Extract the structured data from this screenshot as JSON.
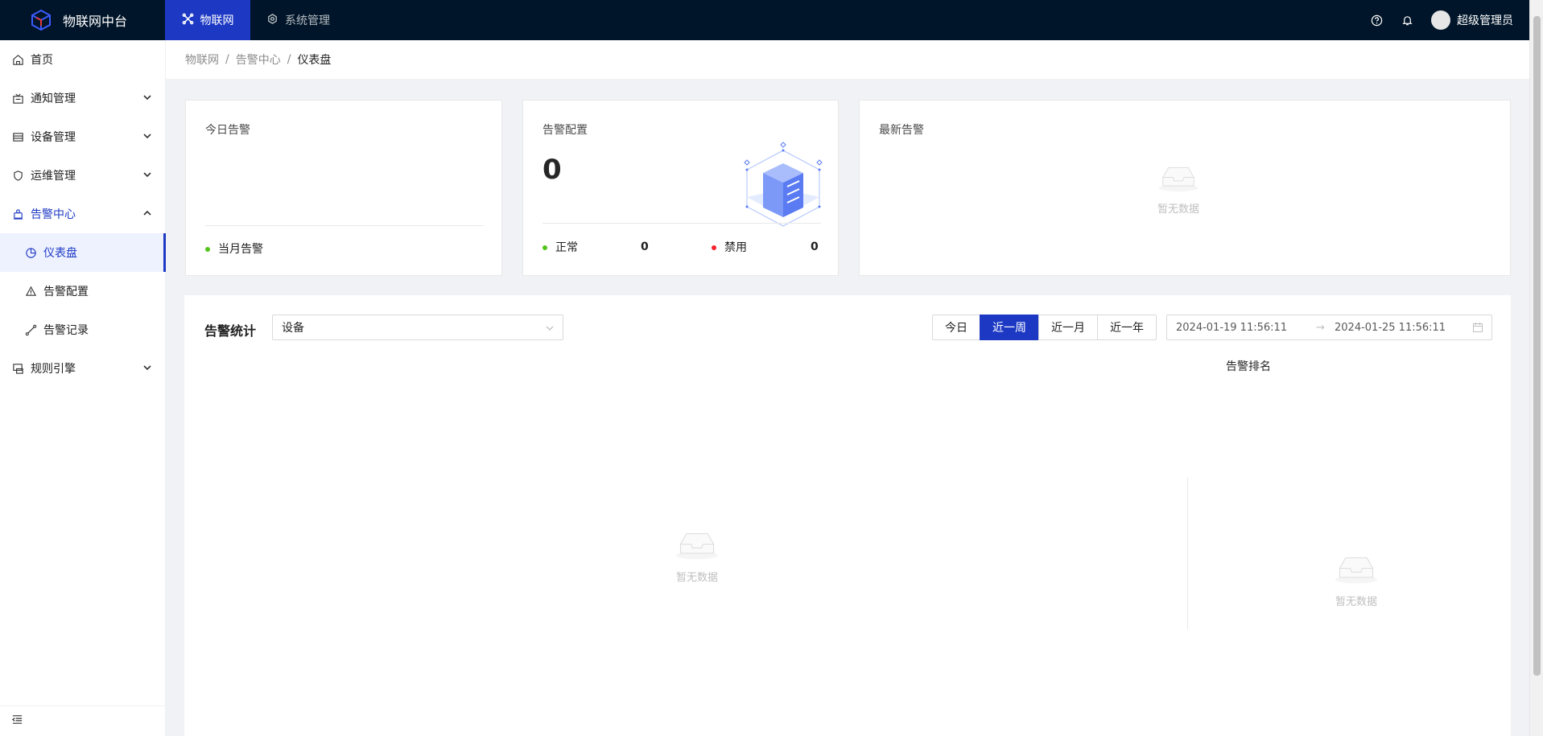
{
  "app": {
    "title": "物联网中台"
  },
  "topnav": {
    "tabs": [
      {
        "label": "物联网",
        "icon": "iot-icon",
        "active": true
      },
      {
        "label": "系统管理",
        "icon": "settings-icon",
        "active": false
      }
    ],
    "user_name": "超级管理员"
  },
  "sidebar": {
    "items": [
      {
        "label": "首页",
        "icon": "home-icon"
      },
      {
        "label": "通知管理",
        "icon": "notification-icon"
      },
      {
        "label": "设备管理",
        "icon": "device-icon"
      },
      {
        "label": "运维管理",
        "icon": "ops-icon"
      },
      {
        "label": "告警中心",
        "icon": "alarm-icon"
      },
      {
        "label": "仪表盘",
        "icon": "dashboard-icon"
      },
      {
        "label": "告警配置",
        "icon": "warning-icon"
      },
      {
        "label": "告警记录",
        "icon": "record-icon"
      },
      {
        "label": "规则引擎",
        "icon": "rule-icon"
      }
    ]
  },
  "breadcrumb": {
    "items": [
      "物联网",
      "告警中心",
      "仪表盘"
    ],
    "separator": "/"
  },
  "today_card": {
    "title": "今日告警",
    "month_label": "当月告警"
  },
  "config_card": {
    "title": "告警配置",
    "total": "0",
    "normal_label": "正常",
    "normal_value": "0",
    "disabled_label": "禁用",
    "disabled_value": "0"
  },
  "latest_card": {
    "title": "最新告警",
    "empty_text": "暂无数据"
  },
  "stats": {
    "title": "告警统计",
    "select_value": "设备",
    "periods": [
      "今日",
      "近一周",
      "近一月",
      "近一年"
    ],
    "active_period": "近一周",
    "range_start": "2024-01-19 11:56:11",
    "range_arrow": "→",
    "range_end": "2024-01-25 11:56:11",
    "ranking_title": "告警排名",
    "chart_empty": "暂无数据",
    "ranking_empty": "暂无数据"
  },
  "colors": {
    "primary": "#1d39c4",
    "header_bg": "#001529",
    "normal_dot": "#52c41a",
    "disabled_dot": "#f5222d"
  }
}
